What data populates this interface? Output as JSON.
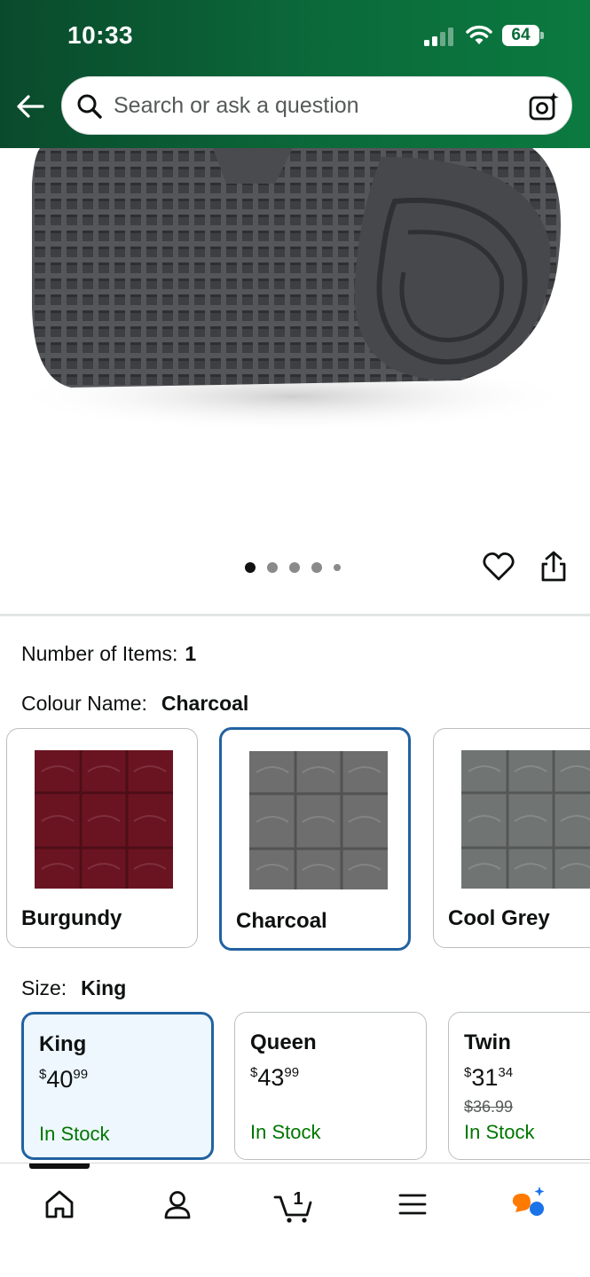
{
  "status_bar": {
    "time": "10:33",
    "battery": "64"
  },
  "search": {
    "placeholder": "Search or ask a question"
  },
  "gallery": {
    "image_count": 5,
    "active_index": 0
  },
  "options": {
    "items_label": "Number of Items:",
    "items_value": "1",
    "colour_label": "Colour Name:",
    "colour_value": "Charcoal",
    "colours": [
      {
        "label": "Burgundy",
        "color": "#6b1421"
      },
      {
        "label": "Charcoal",
        "color": "#6e6e6e"
      },
      {
        "label": "Cool Grey",
        "color": "#707573"
      }
    ],
    "size_label": "Size:",
    "size_value": "King",
    "sizes": [
      {
        "name": "King",
        "currency": "$",
        "whole": "40",
        "fraction": "99",
        "old_price": "",
        "stock": "In Stock"
      },
      {
        "name": "Queen",
        "currency": "$",
        "whole": "43",
        "fraction": "99",
        "old_price": "",
        "stock": "In Stock"
      },
      {
        "name": "Twin",
        "currency": "$",
        "whole": "31",
        "fraction": "34",
        "old_price": "$36.99",
        "stock": "In Stock"
      }
    ]
  },
  "nav": {
    "cart_count": "1"
  },
  "colors": {
    "header": "#0b6a3a",
    "selected_border": "#2162a1",
    "in_stock": "#007600",
    "selected_bg": "#edf7fd"
  },
  "icons": [
    "back-arrow-icon",
    "search-icon",
    "camera-icon",
    "heart-icon",
    "share-icon",
    "home-icon",
    "account-icon",
    "cart-icon",
    "menu-icon",
    "assistant-icon"
  ]
}
